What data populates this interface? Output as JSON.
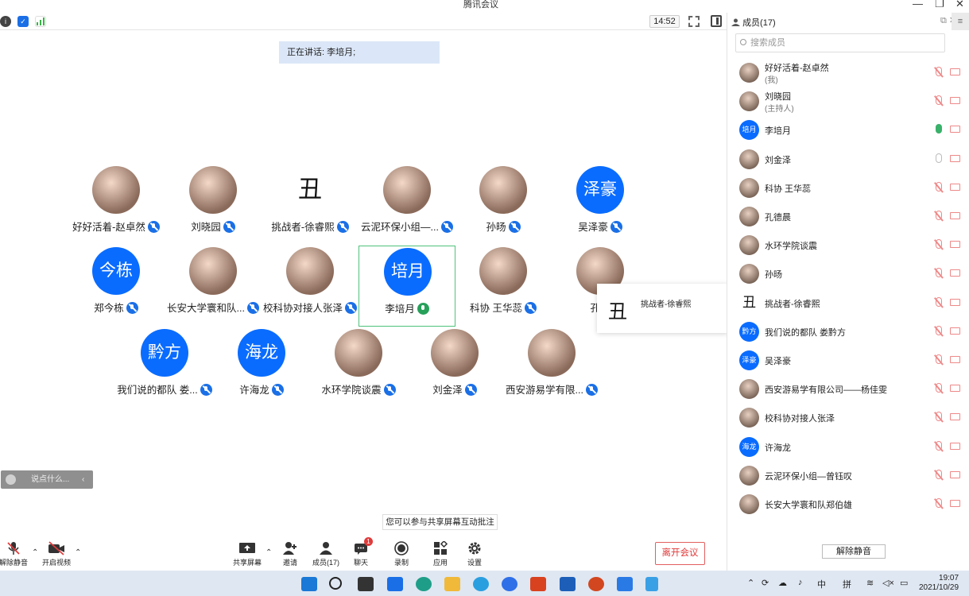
{
  "window": {
    "title": "腾讯会议",
    "minimize": "—",
    "restore": "❐",
    "close": "✕"
  },
  "topbar": {
    "clock": "14:52"
  },
  "speaking": {
    "text": "正在讲话: 李培月;"
  },
  "grid": [
    {
      "name": "好好活着-赵卓然",
      "avatar": "",
      "kind": "img",
      "mic": "blue"
    },
    {
      "name": "刘晓园",
      "avatar": "",
      "kind": "img",
      "mic": "blue"
    },
    {
      "name": "挑战者-徐睿熙",
      "avatar": "丑",
      "kind": "chou",
      "mic": "blue"
    },
    {
      "name": "云泥环保小组—...",
      "avatar": "",
      "kind": "img",
      "mic": "blue"
    },
    {
      "name": "孙旸",
      "avatar": "",
      "kind": "img",
      "mic": "blue"
    },
    {
      "name": "吴泽豪",
      "avatar": "泽豪",
      "kind": "txt",
      "mic": "blue"
    },
    {
      "name": "郑今栋",
      "avatar": "今栋",
      "kind": "txt",
      "mic": "blue"
    },
    {
      "name": "长安大学寰和队...",
      "avatar": "",
      "kind": "img",
      "mic": "blue"
    },
    {
      "name": "校科协对接人张泽",
      "avatar": "",
      "kind": "img",
      "mic": "blue"
    },
    {
      "name": "李培月",
      "avatar": "培月",
      "kind": "txt",
      "mic": "green"
    },
    {
      "name": "科协 王华蕊",
      "avatar": "",
      "kind": "img",
      "mic": "blue"
    },
    {
      "name": "孔德",
      "avatar": "",
      "kind": "img",
      "mic": "none"
    },
    {
      "name": "我们说的都队 娄...",
      "avatar": "黔方",
      "kind": "txt",
      "mic": "blue"
    },
    {
      "name": "许海龙",
      "avatar": "海龙",
      "kind": "txt",
      "mic": "blue"
    },
    {
      "name": "水环学院谈震",
      "avatar": "",
      "kind": "img",
      "mic": "blue"
    },
    {
      "name": "刘金泽",
      "avatar": "",
      "kind": "img",
      "mic": "blue"
    },
    {
      "name": "西安游易学有限...",
      "avatar": "",
      "kind": "img",
      "mic": "blue"
    }
  ],
  "hovercard": {
    "avatar": "丑",
    "name": "挑战者-徐睿熙"
  },
  "chat": {
    "placeholder": "说点什么...",
    "chevron": "‹"
  },
  "tip": "您可以参与共享屏幕互动批注",
  "toolbar": {
    "unmute": "解除静音",
    "video": "开启视频",
    "share": "共享屏幕",
    "invite": "邀请",
    "members": "成员(17)",
    "chat": "聊天",
    "chat_badge": "1",
    "record": "录制",
    "apps": "应用",
    "settings": "设置",
    "leave": "离开会议"
  },
  "panel": {
    "title": "成员(17)",
    "search_placeholder": "搜索成员",
    "menu": "≡",
    "unmute_all": "解除静音",
    "members": [
      {
        "name": "好好活着-赵卓然",
        "sub": "(我)",
        "avatar": "",
        "kind": "pic",
        "mic": "muted"
      },
      {
        "name": "刘晓园",
        "sub": "(主持人)",
        "avatar": "",
        "kind": "pic",
        "mic": "muted"
      },
      {
        "name": "李培月",
        "sub": "",
        "avatar": "培月",
        "kind": "blue",
        "mic": "green"
      },
      {
        "name": "刘金泽",
        "sub": "",
        "avatar": "",
        "kind": "pic",
        "mic": "gray"
      },
      {
        "name": "科协 王华蕊",
        "sub": "",
        "avatar": "",
        "kind": "pic",
        "mic": "muted"
      },
      {
        "name": "孔德晨",
        "sub": "",
        "avatar": "",
        "kind": "pic",
        "mic": "muted"
      },
      {
        "name": "水环学院谈震",
        "sub": "",
        "avatar": "",
        "kind": "pic",
        "mic": "muted"
      },
      {
        "name": "孙旸",
        "sub": "",
        "avatar": "",
        "kind": "pic",
        "mic": "muted"
      },
      {
        "name": "挑战者-徐睿熙",
        "sub": "",
        "avatar": "丑",
        "kind": "chou",
        "mic": "muted"
      },
      {
        "name": "我们说的都队 娄黔方",
        "sub": "",
        "avatar": "黔方",
        "kind": "blue",
        "mic": "muted"
      },
      {
        "name": "吴泽豪",
        "sub": "",
        "avatar": "泽豪",
        "kind": "blue",
        "mic": "muted"
      },
      {
        "name": "西安游易学有限公司——杨佳雯",
        "sub": "",
        "avatar": "",
        "kind": "pic",
        "mic": "muted"
      },
      {
        "name": "校科协对接人张泽",
        "sub": "",
        "avatar": "",
        "kind": "pic",
        "mic": "muted"
      },
      {
        "name": "许海龙",
        "sub": "",
        "avatar": "海龙",
        "kind": "blue",
        "mic": "muted"
      },
      {
        "name": "云泥环保小组—曾钰叹",
        "sub": "",
        "avatar": "",
        "kind": "pic",
        "mic": "muted"
      },
      {
        "name": "长安大学寰和队郑伯雄",
        "sub": "",
        "avatar": "",
        "kind": "pic",
        "mic": "muted"
      }
    ]
  },
  "taskbar": {
    "ime_lang": "中",
    "ime_mode": "拼",
    "time": "19:07",
    "date": "2021/10/29"
  },
  "colors": {
    "accent": "#0a6cff",
    "speaking_bg": "#dbe7f8",
    "leave": "#e03b3b",
    "active_border": "#4fc27d"
  }
}
